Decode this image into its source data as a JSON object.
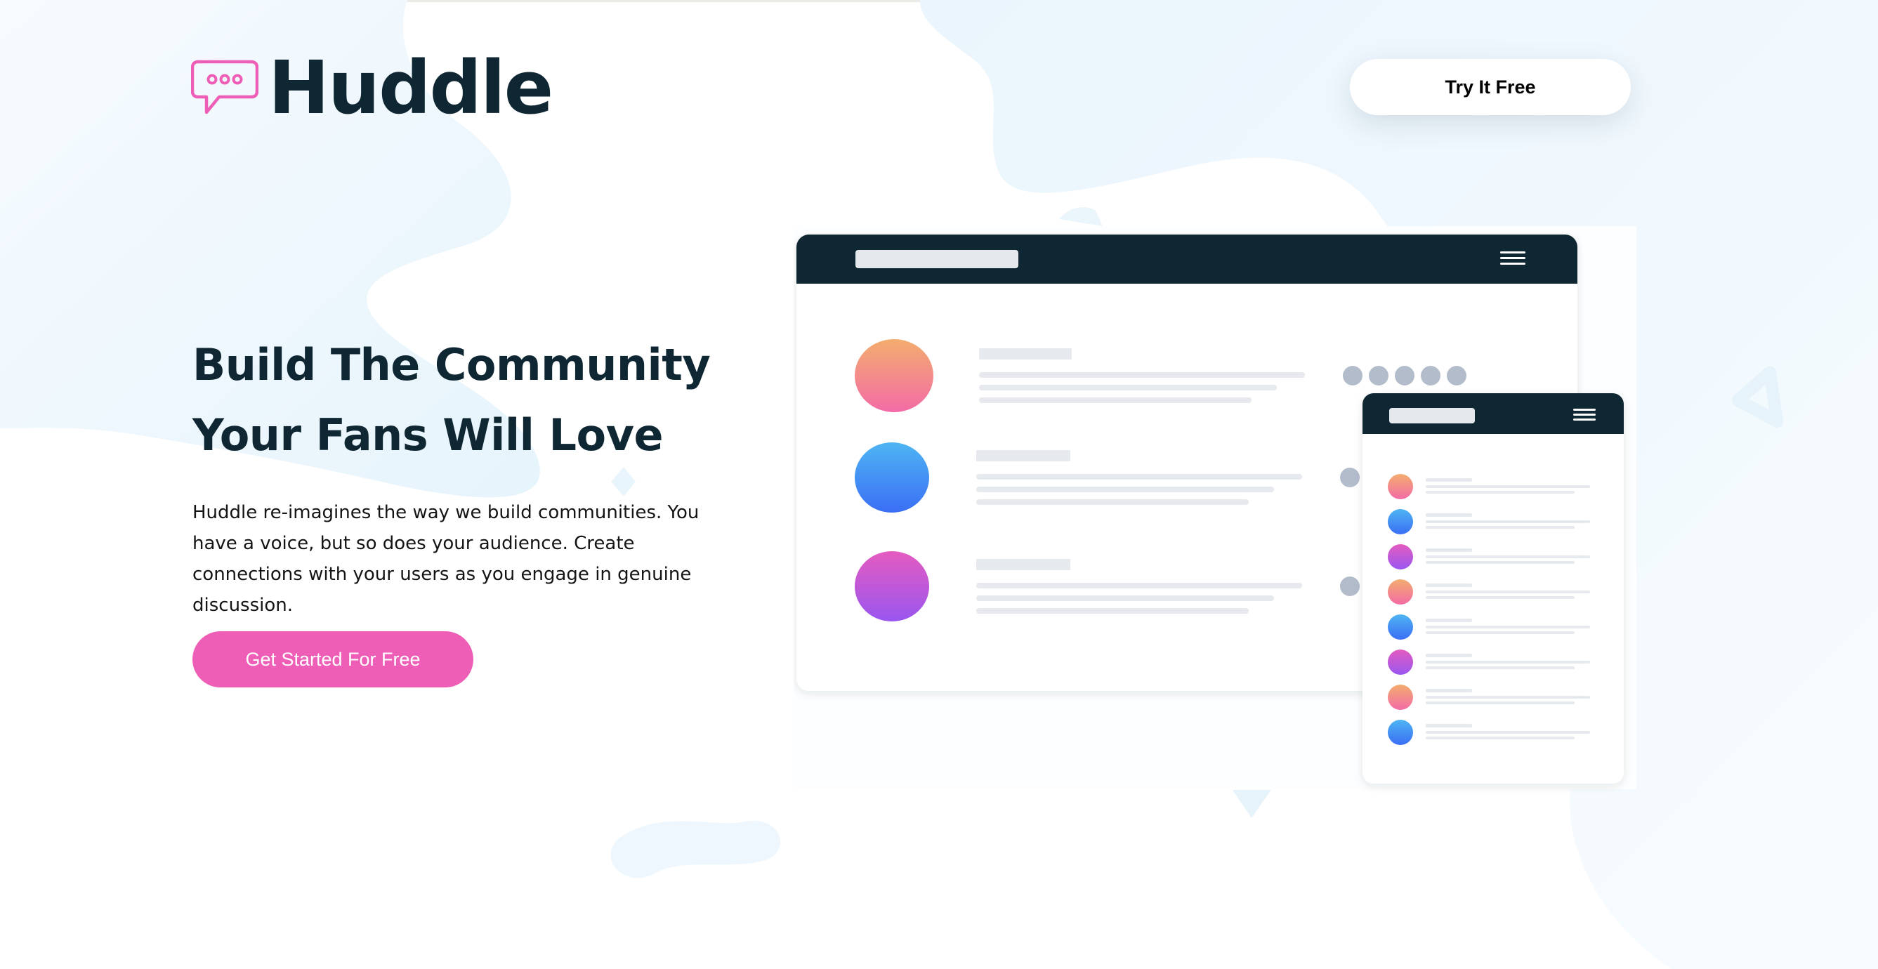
{
  "brand": {
    "name": "Huddle",
    "logo_icon": "speech-bubble-icon",
    "accent": "#ee5eb7",
    "dark": "#0f2733"
  },
  "header": {
    "cta_label": "Try It Free"
  },
  "hero": {
    "title_line1": "Build The Community",
    "title_line2": "Your Fans Will Love",
    "description": "Huddle re-imagines the way we build communities. You have a voice, but so does your audience. Create connections with your users as you engage in genuine discussion.",
    "cta_label": "Get Started For Free"
  },
  "mockup": {
    "desktop_rows": 3,
    "mobile_rows": 8,
    "menu_icon": "hamburger-menu-icon"
  }
}
